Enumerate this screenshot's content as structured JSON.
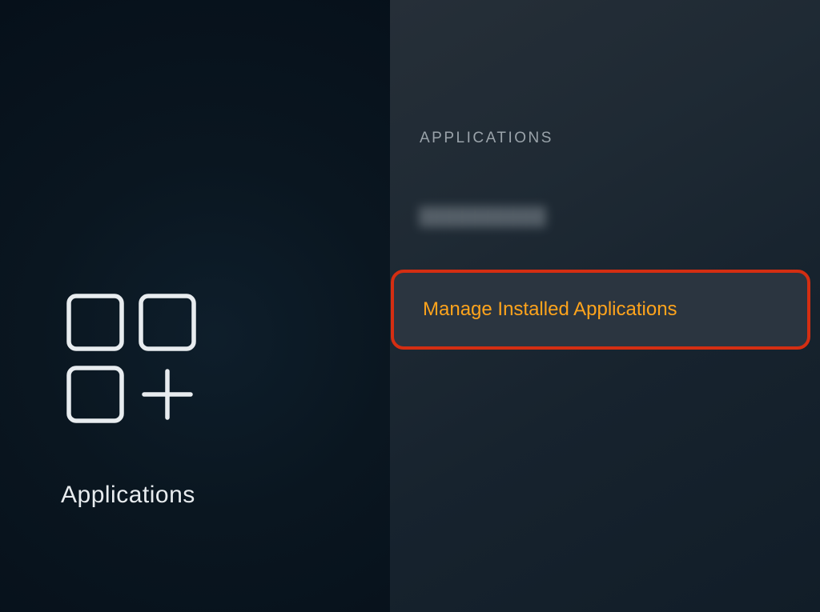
{
  "left": {
    "title": "Applications"
  },
  "right": {
    "section_header": "APPLICATIONS",
    "items": [
      {
        "label": "▇▇▇▇▇▇▇",
        "obscured": true
      },
      {
        "label": "Manage Installed Applications",
        "selected": true
      }
    ]
  }
}
